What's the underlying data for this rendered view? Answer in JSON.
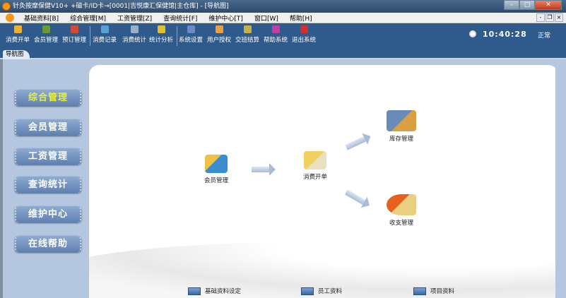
{
  "window": {
    "title": "针灸按摩保健V10+ +磁卡/ID卡→[0001|吉悦康汇保健馆|主仓库] - [导航图]",
    "minimize": "–",
    "maximize": "□",
    "close": "✕"
  },
  "menu": [
    "基础资料[B]",
    "综合管理[M]",
    "工资管理[Z]",
    "查询统计[F]",
    "维护中心[T]",
    "窗口[W]",
    "帮助[H]"
  ],
  "mdi": [
    "-",
    "❐",
    "×"
  ],
  "toolbar": [
    {
      "label": "消费开单",
      "icon": "bill-icon",
      "color": "#e8b33a"
    },
    {
      "label": "会员管理",
      "icon": "member-icon",
      "color": "#6a9a3a"
    },
    {
      "label": "预订管理",
      "icon": "booking-icon",
      "color": "#d04a3a"
    },
    {
      "label": "消费记录",
      "icon": "record-icon",
      "color": "#5aa0d8"
    },
    {
      "label": "消费统计",
      "icon": "stats-icon",
      "color": "#9ab0c8"
    },
    {
      "label": "统计分析",
      "icon": "analysis-icon",
      "color": "#e0c030"
    },
    {
      "label": "系统设置",
      "icon": "settings-icon",
      "color": "#6a8ac8"
    },
    {
      "label": "用户授权",
      "icon": "user-auth-icon",
      "color": "#e8a040"
    },
    {
      "label": "交班结算",
      "icon": "shift-icon",
      "color": "#c8b048"
    },
    {
      "label": "帮助系统",
      "icon": "help-icon",
      "color": "#c040a0"
    },
    {
      "label": "退出系统",
      "icon": "exit-icon",
      "color": "#d03030"
    }
  ],
  "time": "10:40:28",
  "status": "正常",
  "tab": "导航图",
  "nav": [
    "综合管理",
    "会员管理",
    "工资管理",
    "查询统计",
    "维护中心",
    "在线帮助"
  ],
  "diagram": {
    "member": "会员管理",
    "bill": "消费开单",
    "stock": "库存管理",
    "finance": "收支管理"
  },
  "links": [
    "基础资料设定",
    "员工资料",
    "项目资料"
  ]
}
